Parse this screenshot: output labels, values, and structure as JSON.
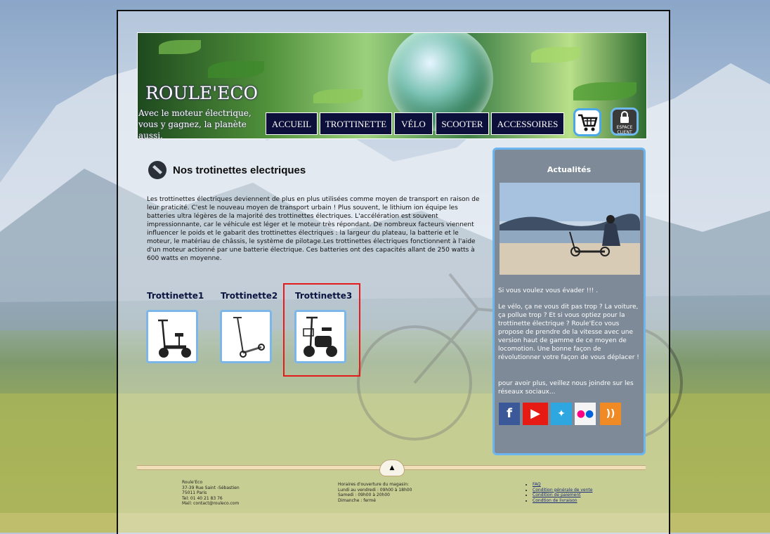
{
  "header": {
    "brand": "ROULE'ECO",
    "slogan": "Avec le moteur électrique, vous y gagnez, la planète aussi.",
    "nav": [
      "ACCUEIL",
      "TROTTINETTE",
      "VÉLO",
      "SCOOTER",
      "ACCESSOIRES"
    ],
    "cart_icon": "shopping-cart-icon",
    "espace_line1": "ESPACE",
    "espace_line2": "CLIENT"
  },
  "main": {
    "title": "Nos trotinettes electriques",
    "intro": "Les trottinettes électriques deviennent de plus en plus utilisées comme moyen de transport en raison de leur praticité. C'est le nouveau moyen de transport urbain ! Plus souvent, le lithium ion équipe les batteries ultra légères de la majorité des trottinettes électriques. L'accélération est souvent impressionnante, car le véhicule est léger et le moteur très répondant. De nombreux facteurs viennent influencer le poids et le gabarit des trottinettes électriques : la largeur du plateau, la batterie et le moteur, le matériau de châssis, le système de pilotage.Les trottinettes électriques fonctionnent à l'aide d'un moteur actionné par une batterie électrique. Ces batteries ont des capacités allant de 250 watts à 600 watts en moyenne.",
    "products": [
      "Trottinette1",
      "Trottinette2",
      "Trottinette3"
    ]
  },
  "sidebar": {
    "title": "Actualités",
    "text1": "Si vous voulez vous évader !!! .",
    "text2": "Le vélo, ça ne vous dit pas trop ? La voiture, ça pollue trop ? Et si vous optiez pour la trottinette électrique ? Roule'Eco vous propose de prendre de la vitesse avec une version haut de gamme de ce moyen de locomotion. Une bonne façon de révolutionner votre façon de vous déplacer !",
    "text3": "pour avoir plus, veillez nous joindre sur les réseaux sociaux...",
    "social": [
      "facebook-icon",
      "youtube-icon",
      "twitter-icon",
      "flickr-icon",
      "rss-icon"
    ]
  },
  "footer": {
    "address": [
      "Roule'Eco",
      "37-39 Rue Saint -Sébastien",
      "75011 Paris",
      "Tel: 01 40 21 83 76",
      "Mail: contact@rouleco.com"
    ],
    "hours": [
      "Horaires d'ouverture du magasin:",
      "Lundi au vendredi : 09h00 à 18h00",
      "Samedi : 09h00 à 20h00",
      "Dimanche : fermé"
    ],
    "links": [
      "FAQ",
      "Condition générale de vente",
      "Condition de paiement",
      "Condtion de livraison"
    ],
    "up_arrow": "▲"
  },
  "colors": {
    "nav_bg": "#0c0f3a",
    "accent": "#4aa7e8",
    "highlight": "#e31b1b",
    "sidebar_bg": "#7e8a97"
  }
}
